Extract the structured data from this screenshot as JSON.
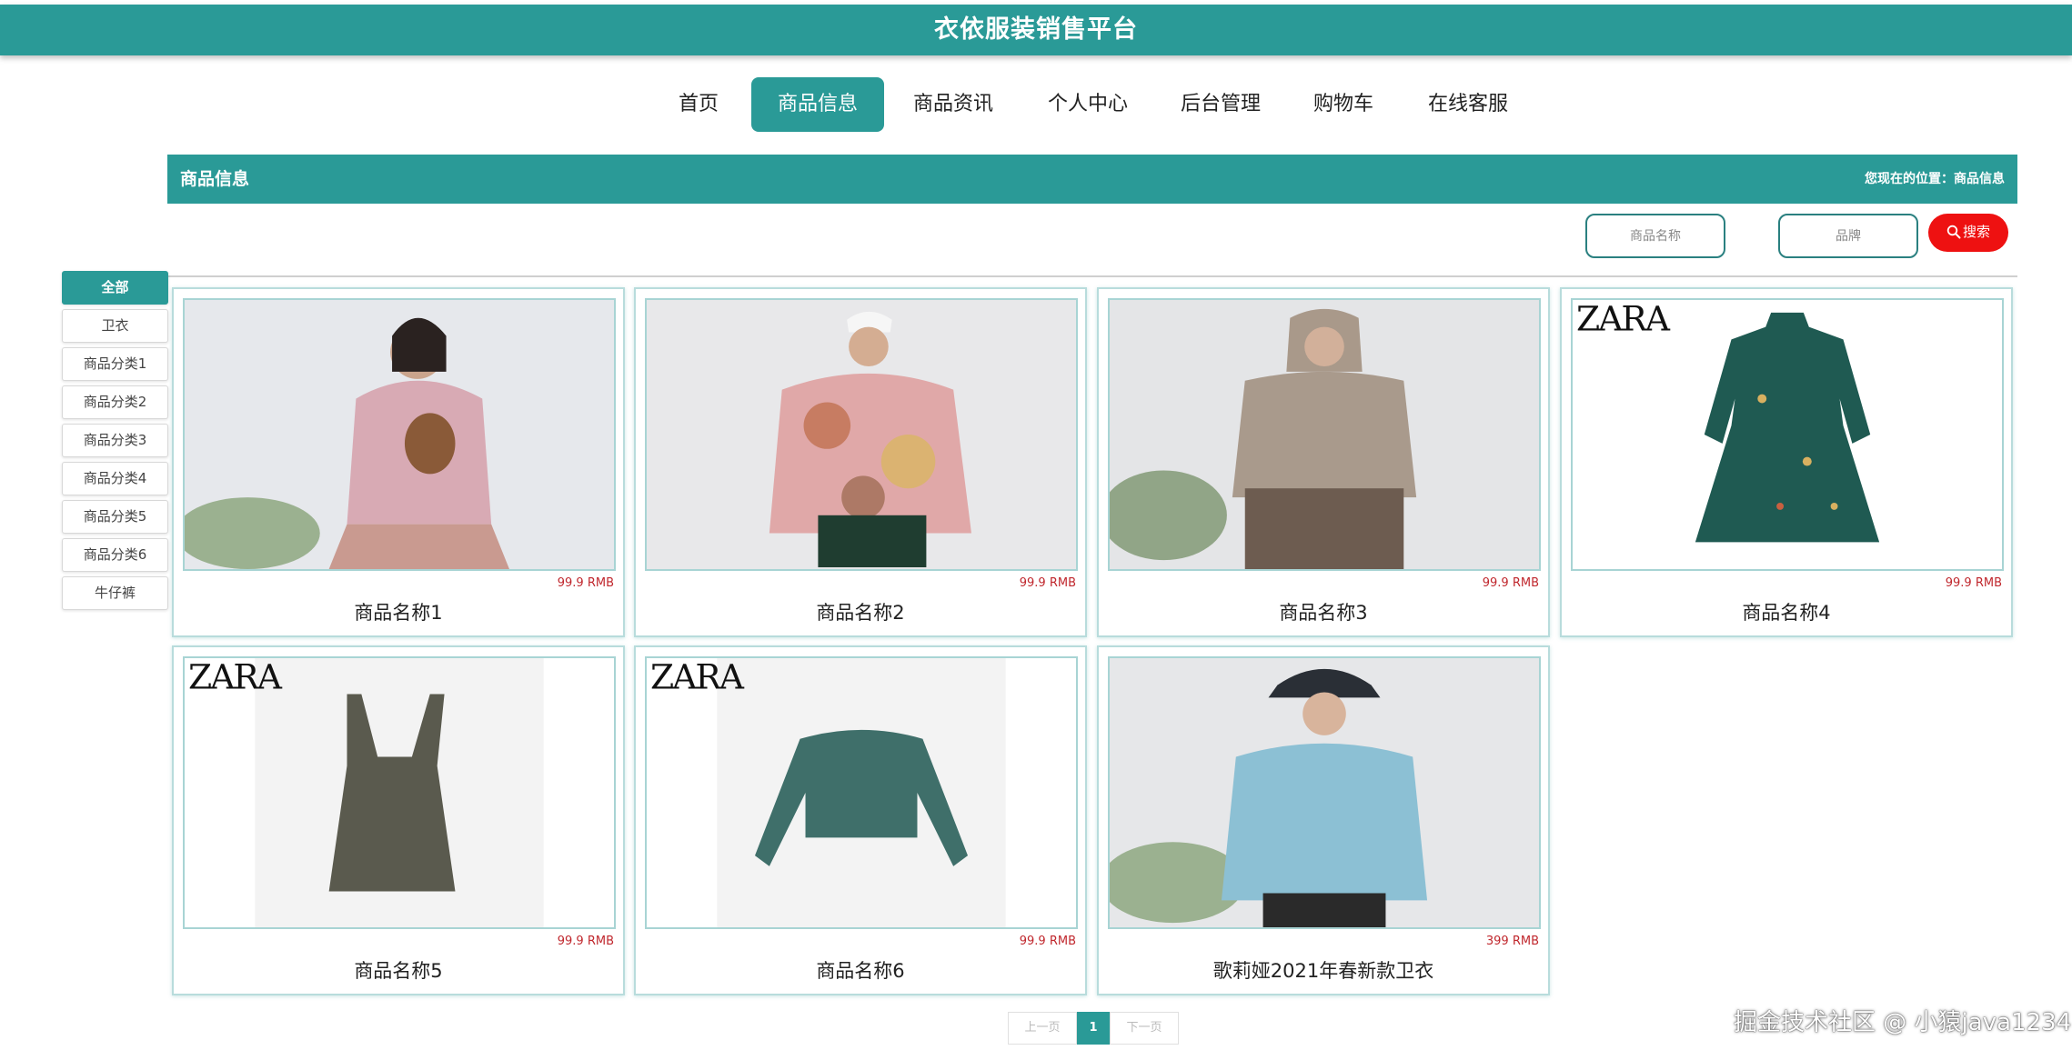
{
  "header": {
    "title": "衣依服装销售平台"
  },
  "nav": {
    "items": [
      {
        "label": "首页"
      },
      {
        "label": "商品信息"
      },
      {
        "label": "商品资讯"
      },
      {
        "label": "个人中心"
      },
      {
        "label": "后台管理"
      },
      {
        "label": "购物车"
      },
      {
        "label": "在线客服"
      }
    ],
    "active": "商品信息"
  },
  "section": {
    "title": "商品信息",
    "breadcrumb": "您现在的位置：商品信息"
  },
  "search": {
    "name_placeholder": "商品名称",
    "brand_placeholder": "品牌",
    "button_label": "搜索"
  },
  "categories": {
    "items": [
      {
        "label": "全部"
      },
      {
        "label": "卫衣"
      },
      {
        "label": "商品分类1"
      },
      {
        "label": "商品分类2"
      },
      {
        "label": "商品分类3"
      },
      {
        "label": "商品分类4"
      },
      {
        "label": "商品分类5"
      },
      {
        "label": "商品分类6"
      },
      {
        "label": "牛仔裤"
      }
    ],
    "active": "全部"
  },
  "products": [
    {
      "name": "商品名称1",
      "price": "99.9 RMB"
    },
    {
      "name": "商品名称2",
      "price": "99.9 RMB"
    },
    {
      "name": "商品名称3",
      "price": "99.9 RMB"
    },
    {
      "name": "商品名称4",
      "price": "99.9 RMB"
    },
    {
      "name": "商品名称5",
      "price": "99.9 RMB"
    },
    {
      "name": "商品名称6",
      "price": "99.9 RMB"
    },
    {
      "name": "歌莉娅2021年春新款卫衣",
      "price": "399 RMB"
    }
  ],
  "pagination": {
    "prev": "上一页",
    "current": "1",
    "next": "下一页"
  },
  "watermark": "掘金技术社区 @ 小猿java1234",
  "colors": {
    "brand": "#2a9a97",
    "price": "#c0272d",
    "search_button": "#ee1111"
  }
}
